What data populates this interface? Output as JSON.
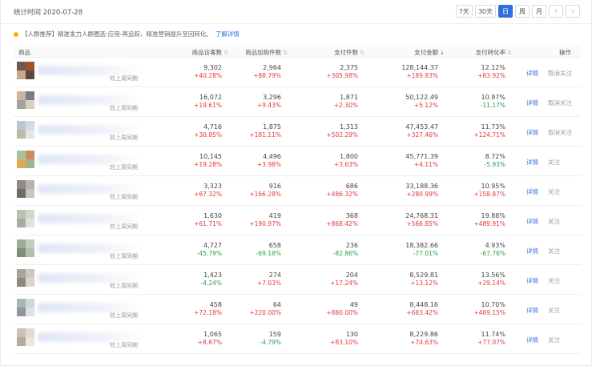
{
  "header": {
    "date_label": "统计时间 2020-07-28",
    "periods": [
      "7天",
      "30天",
      "日",
      "周",
      "月"
    ],
    "active_period": "日",
    "prev_icon": "chevron-left-icon",
    "next_icon": "chevron-right-icon"
  },
  "notice": {
    "text": "【人群推荐】精准发力人群圈选-应用-再追踪，精准营销提升至回转化。",
    "link": "了解详情",
    "accent": "#f5b400"
  },
  "columns": {
    "product": "商品",
    "visitors": "商品访客数",
    "cart": "商品加购件数",
    "paid_items": "支付件数",
    "paid_amount": "支付金额",
    "conversion": "支付转化率",
    "actions": "操作"
  },
  "compare_label": "较上周同期",
  "action_detail": "详情",
  "colors": {
    "up": "#e4393c",
    "down": "#2b9f4a",
    "link": "#2e6fe0"
  },
  "rows": [
    {
      "visitors": "9,302",
      "visitors_c": "+40.28%",
      "cart": "2,964",
      "cart_c": "+88.79%",
      "paid": "2,375",
      "paid_c": "+305.98%",
      "amount": "128,144.37",
      "amount_c": "+189.83%",
      "conv": "12.12%",
      "conv_c": "+83.92%",
      "follow": "取消关注",
      "thumb": [
        "#6b5a4e",
        "#a0522d",
        "#c9a88a",
        "#5b4a3c"
      ]
    },
    {
      "visitors": "16,072",
      "visitors_c": "+19.61%",
      "cart": "3,296",
      "cart_c": "+9.43%",
      "paid": "1,871",
      "paid_c": "+2.30%",
      "amount": "50,122.49",
      "amount_c": "+5.12%",
      "conv": "10.97%",
      "conv_c": "-11.17%",
      "follow": "取消关注",
      "thumb": [
        "#c9b7a4",
        "#7a7d86",
        "#a7a29a",
        "#d8cfc4"
      ]
    },
    {
      "visitors": "4,716",
      "visitors_c": "+30.85%",
      "cart": "1,875",
      "cart_c": "+181.11%",
      "paid": "1,313",
      "paid_c": "+502.29%",
      "amount": "47,453.47",
      "amount_c": "+327.46%",
      "conv": "11.73%",
      "conv_c": "+124.71%",
      "follow": "取消关注",
      "thumb": [
        "#b9c7cf",
        "#d4d9dc",
        "#c2b8a8",
        "#e2e4e5"
      ]
    },
    {
      "visitors": "10,145",
      "visitors_c": "+19.28%",
      "cart": "4,496",
      "cart_c": "+3.98%",
      "paid": "1,800",
      "paid_c": "+3.63%",
      "amount": "45,771.39",
      "amount_c": "+4.11%",
      "conv": "8.72%",
      "conv_c": "-5.93%",
      "follow": "关注",
      "thumb": [
        "#a9c49a",
        "#c98b5f",
        "#e0a85b",
        "#9fb58f"
      ]
    },
    {
      "visitors": "3,323",
      "visitors_c": "+67.32%",
      "cart": "916",
      "cart_c": "+166.28%",
      "paid": "686",
      "paid_c": "+486.32%",
      "amount": "33,188.36",
      "amount_c": "+280.99%",
      "conv": "10.95%",
      "conv_c": "+158.87%",
      "follow": "关注",
      "thumb": [
        "#8e8a84",
        "#b6b3ad",
        "#6f6c67",
        "#c8c5bf"
      ]
    },
    {
      "visitors": "1,630",
      "visitors_c": "+61.71%",
      "cart": "419",
      "cart_c": "+190.97%",
      "paid": "368",
      "paid_c": "+868.42%",
      "amount": "24,768.31",
      "amount_c": "+566.85%",
      "conv": "19.88%",
      "conv_c": "+489.91%",
      "follow": "关注",
      "thumb": [
        "#b7c3b1",
        "#d1d6cf",
        "#a5ae9f",
        "#e0e3dd"
      ]
    },
    {
      "visitors": "4,727",
      "visitors_c": "-45.79%",
      "cart": "658",
      "cart_c": "-69.18%",
      "paid": "236",
      "paid_c": "-82.86%",
      "amount": "18,382.66",
      "amount_c": "-77.01%",
      "conv": "4.93%",
      "conv_c": "-67.76%",
      "follow": "关注",
      "thumb": [
        "#9cab95",
        "#c4ccbf",
        "#7f8e7a",
        "#b5bfae"
      ]
    },
    {
      "visitors": "1,423",
      "visitors_c": "-4.24%",
      "cart": "274",
      "cart_c": "+7.03%",
      "paid": "204",
      "paid_c": "+17.24%",
      "amount": "8,529.81",
      "amount_c": "+13.12%",
      "conv": "13.56%",
      "conv_c": "+29.14%",
      "follow": "关注",
      "thumb": [
        "#a8a39b",
        "#ccc7bf",
        "#8d8880",
        "#d9d4cc"
      ]
    },
    {
      "visitors": "458",
      "visitors_c": "+72.18%",
      "cart": "64",
      "cart_c": "+220.00%",
      "paid": "49",
      "paid_c": "+880.00%",
      "amount": "8,448.16",
      "amount_c": "+683.42%",
      "conv": "10.70%",
      "conv_c": "+469.15%",
      "follow": "关注",
      "thumb": [
        "#a9b4b8",
        "#cfd5d8",
        "#8d989c",
        "#dde2e4"
      ]
    },
    {
      "visitors": "1,065",
      "visitors_c": "+8.67%",
      "cart": "159",
      "cart_c": "-4.79%",
      "paid": "130",
      "paid_c": "+83.10%",
      "amount": "8,229.86",
      "amount_c": "+74.63%",
      "conv": "11.74%",
      "conv_c": "+77.07%",
      "follow": "关注",
      "thumb": [
        "#c9c2b5",
        "#e0dbd2",
        "#b2ab9e",
        "#ebe7e0"
      ]
    }
  ]
}
